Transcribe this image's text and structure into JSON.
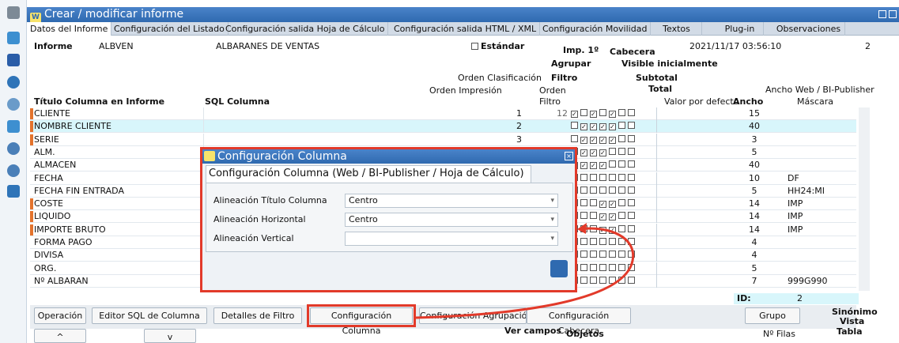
{
  "window": {
    "title": "Crear / modificar informe"
  },
  "tabs": [
    "Datos del Informe",
    "Configuración del Listado",
    "Configuración salida Hoja de Cálculo",
    "Configuración salida HTML / XML",
    "Configuración Movilidad",
    "Textos",
    "Plug-in",
    "Observaciones"
  ],
  "header": {
    "informe_label": "Informe",
    "informe_code": "ALBVEN",
    "informe_name": "ALBARANES DE VENTAS",
    "estandar_label": "Estándar",
    "timestamp": "2021/11/17 03:56:10",
    "count": "2"
  },
  "col_headers": {
    "imp1": "Imp. 1º",
    "cabecera": "Cabecera",
    "agrupar": "Agrupar",
    "visible": "Visible inicialmente",
    "orden_clas": "Orden Clasificación",
    "filtro": "Filtro",
    "subtotal": "Subtotal",
    "orden_imp": "Orden Impresión",
    "orden": "Orden",
    "total": "Total",
    "ancho_web": "Ancho Web / BI-Publisher",
    "titulo": "Título Columna en Informe",
    "sql": "SQL Columna",
    "filtro2": "Filtro",
    "valor_def": "Valor por defecto",
    "ancho": "Ancho",
    "mascara": "Máscara"
  },
  "rows": [
    {
      "title": "CLIENTE",
      "mark": true,
      "orden": "1",
      "filtro": "12",
      "checks": [
        1,
        0,
        1,
        0,
        1,
        0,
        0
      ],
      "ancho": "15",
      "mascara": ""
    },
    {
      "title": "NOMBRE CLIENTE",
      "mark": true,
      "orden": "2",
      "filtro": "",
      "checks": [
        0,
        1,
        1,
        1,
        1,
        0,
        0
      ],
      "ancho": "40",
      "mascara": ""
    },
    {
      "title": "SERIE",
      "mark": true,
      "orden": "3",
      "filtro": "",
      "checks": [
        0,
        1,
        1,
        1,
        1,
        0,
        0
      ],
      "ancho": "3",
      "mascara": ""
    },
    {
      "title": "ALM.",
      "mark": false,
      "orden": "",
      "filtro": "",
      "checks": [
        0,
        1,
        1,
        1,
        0,
        0,
        0
      ],
      "ancho": "5",
      "mascara": ""
    },
    {
      "title": "ALMACEN",
      "mark": false,
      "orden": "",
      "filtro": "",
      "checks": [
        1,
        1,
        1,
        1,
        0,
        0,
        0
      ],
      "ancho": "40",
      "mascara": ""
    },
    {
      "title": "FECHA",
      "mark": false,
      "orden": "",
      "filtro": "",
      "checks": [
        0,
        0,
        0,
        0,
        0,
        0,
        0
      ],
      "ancho": "10",
      "mascara": "DF"
    },
    {
      "title": "FECHA FIN ENTRADA",
      "mark": false,
      "orden": "",
      "filtro": "",
      "checks": [
        0,
        0,
        0,
        0,
        0,
        0,
        0
      ],
      "ancho": "5",
      "mascara": "HH24:MI"
    },
    {
      "title": "COSTE",
      "mark": true,
      "orden": "",
      "filtro": "",
      "checks": [
        0,
        0,
        0,
        1,
        1,
        0,
        0
      ],
      "ancho": "14",
      "mascara": "IMP"
    },
    {
      "title": "LIQUIDO",
      "mark": true,
      "orden": "",
      "filtro": "",
      "checks": [
        0,
        0,
        0,
        1,
        1,
        0,
        0
      ],
      "ancho": "14",
      "mascara": "IMP"
    },
    {
      "title": "IMPORTE BRUTO",
      "mark": true,
      "orden": "",
      "filtro": "",
      "checks": [
        0,
        0,
        0,
        1,
        1,
        0,
        0
      ],
      "ancho": "14",
      "mascara": "IMP"
    },
    {
      "title": "FORMA PAGO",
      "mark": false,
      "orden": "",
      "filtro": "",
      "checks": [
        0,
        0,
        0,
        0,
        0,
        0,
        0
      ],
      "ancho": "4",
      "mascara": ""
    },
    {
      "title": "DIVISA",
      "mark": false,
      "orden": "",
      "filtro": "",
      "checks": [
        0,
        0,
        0,
        0,
        0,
        0,
        0
      ],
      "ancho": "4",
      "mascara": ""
    },
    {
      "title": "ORG.",
      "mark": false,
      "orden": "",
      "filtro": "",
      "checks": [
        0,
        0,
        0,
        0,
        0,
        0,
        0
      ],
      "ancho": "5",
      "mascara": ""
    },
    {
      "title": "Nº ALBARAN",
      "mark": false,
      "orden": "",
      "filtro": "",
      "checks": [
        0,
        0,
        0,
        0,
        0,
        0,
        0
      ],
      "ancho": "7",
      "mascara": "999G990"
    }
  ],
  "id_row": {
    "label": "ID:",
    "value": "2"
  },
  "bottom_buttons": {
    "operacion": "Operación",
    "editor": "Editor SQL de Columna",
    "detalles": "Detalles de Filtro",
    "config_col": "Configuración Columna",
    "config_agr": "Configuración Agrupación",
    "config_cab": "Configuración Cabecera",
    "grupo": "Grupo"
  },
  "sinonimo": {
    "l1": "Sinónimo",
    "l2": "Vista",
    "l3": "Tabla"
  },
  "footer": {
    "ver_campos": "Ver campos",
    "objetos": "Objetos",
    "num_filas": "Nº Filas",
    "up": "^",
    "down": "v"
  },
  "modal": {
    "title": "Configuración Columna",
    "tab": "Configuración Columna (Web / BI-Publisher / Hoja de Cálculo)",
    "fields": [
      {
        "label": "Alineación Título Columna",
        "value": "Centro"
      },
      {
        "label": "Alineación Horizontal",
        "value": "Centro"
      },
      {
        "label": "Alineación Vertical",
        "value": ""
      }
    ]
  },
  "colors": {
    "accent": "#2f6ab0",
    "highlight": "#e23a2a",
    "mark": "#e3732d"
  }
}
